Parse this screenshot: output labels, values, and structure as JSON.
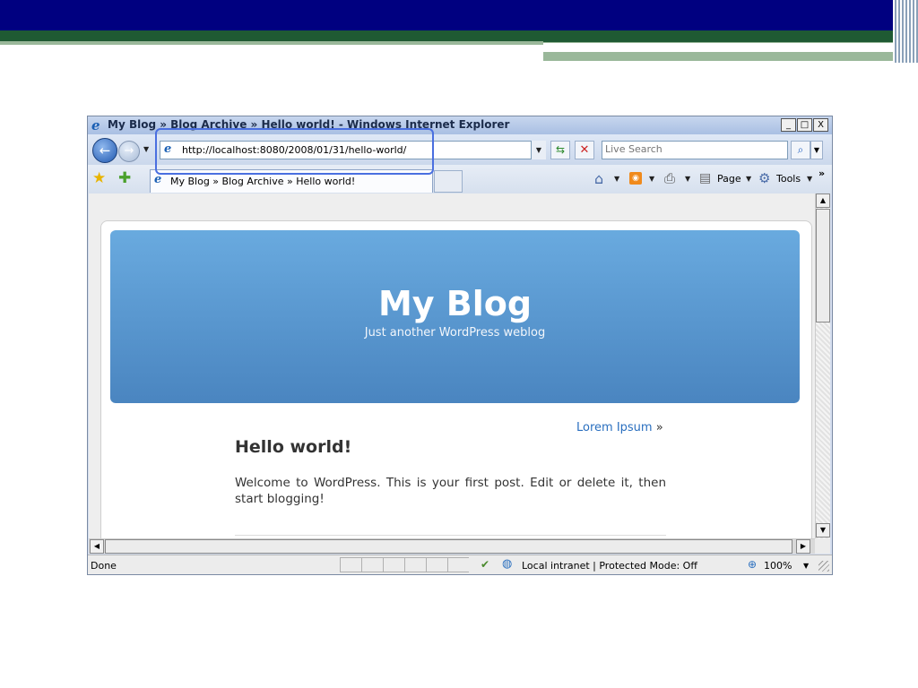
{
  "window": {
    "title": "My Blog » Blog Archive » Hello world! - Windows Internet Explorer",
    "minimize": "_",
    "maximize": "□",
    "close": "X"
  },
  "nav": {
    "back_glyph": "←",
    "forward_glyph": "→",
    "address_url": "http://localhost:8080/2008/01/31/hello-world/",
    "search_placeholder": "Live Search"
  },
  "tabs": [
    {
      "label": "My Blog » Blog Archive » Hello world!"
    }
  ],
  "commandbar": {
    "page_label": "Page",
    "tools_label": "Tools",
    "more_label": "»"
  },
  "blog": {
    "title": "My Blog",
    "description": "Just another WordPress weblog",
    "post_nav_link": "Lorem Ipsum",
    "post_nav_arrow": "»",
    "post_title": "Hello world!",
    "post_body": "Welcome to WordPress. This is your first post. Edit or delete it, then start blogging!"
  },
  "status": {
    "text": "Done",
    "zone": "Local intranet | Protected Mode: Off",
    "zoom": "100%"
  },
  "icons": {
    "ie": "ie-logo-icon",
    "favorites": "star-icon",
    "add_favorite": "add-star-icon",
    "home": "home-icon",
    "feeds": "rss-icon",
    "print": "printer-icon",
    "page": "page-icon",
    "tools": "gear-icon",
    "security": "security-icon",
    "zone": "globe-icon",
    "zoom": "magnifier-icon"
  },
  "colors": {
    "slide_navy": "#000080",
    "slide_green": "#1f5a33",
    "header_blue": "#5a98d2",
    "link_blue": "#2a6fbf",
    "highlight_border": "#4a6fe0"
  }
}
